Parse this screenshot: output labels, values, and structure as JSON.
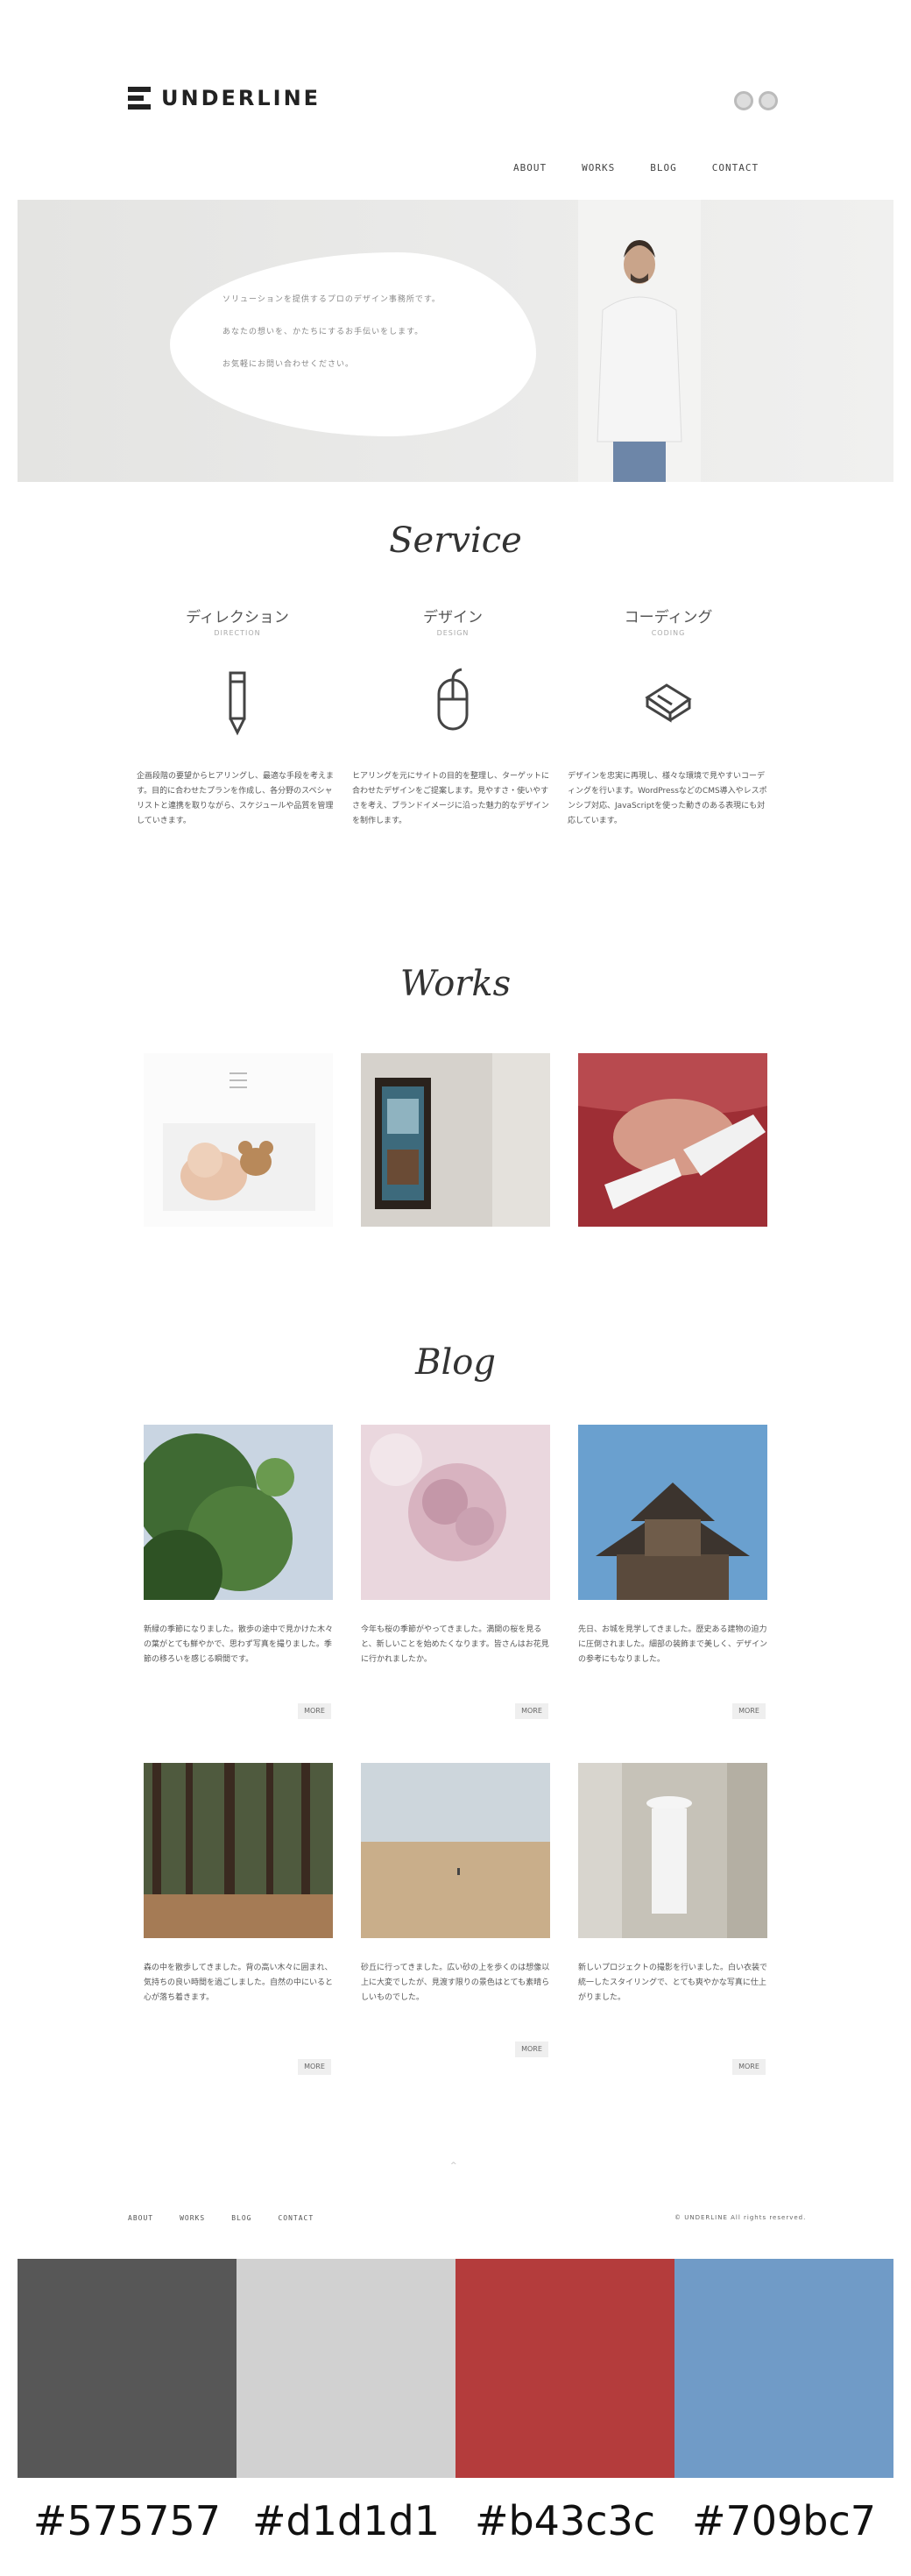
{
  "brand": {
    "name": "UNDERLINE"
  },
  "nav": [
    "ABOUT",
    "WORKS",
    "BLOG",
    "CONTACT"
  ],
  "hero": {
    "lines": [
      "ソリューションを提供するプロのデザイン事務所です。",
      "あなたの想いを、かたちにするお手伝いをします。",
      "お気軽にお問い合わせください。"
    ]
  },
  "sections": {
    "service": "Service",
    "works": "Works",
    "blog": "Blog"
  },
  "services": [
    {
      "title": "ディレクション",
      "sub": "DIRECTION",
      "icon": "pencil-icon",
      "text": "企画段階の要望からヒアリングし、最適な手段を考えます。目的に合わせたプランを作成し、各分野のスペシャリストと連携を取りながら、スケジュールや品質を管理していきます。"
    },
    {
      "title": "デザイン",
      "sub": "DESIGN",
      "icon": "mouse-icon",
      "text": "ヒアリングを元にサイトの目的を整理し、ターゲットに合わせたデザインをご提案します。見やすさ・使いやすさを考え、ブランドイメージに沿った魅力的なデザインを制作します。"
    },
    {
      "title": "コーディング",
      "sub": "CODING",
      "icon": "eraser-icon",
      "text": "デザインを忠実に再現し、様々な環境で見やすいコーディングを行います。WordPressなどのCMS導入やレスポンシブ対応、JavaScriptを使った動きのある表現にも対応しています。"
    }
  ],
  "blog": [
    {
      "text": "新緑の季節になりました。散歩の途中で見かけた木々の葉がとても鮮やかで、思わず写真を撮りました。季節の移ろいを感じる瞬間です。"
    },
    {
      "text": "今年も桜の季節がやってきました。満開の桜を見ると、新しいことを始めたくなります。皆さんはお花見に行かれましたか。"
    },
    {
      "text": "先日、お城を見学してきました。歴史ある建物の迫力に圧倒されました。細部の装飾まで美しく、デザインの参考にもなりました。"
    },
    {
      "text": "森の中を散歩してきました。背の高い木々に囲まれ、気持ちの良い時間を過ごしました。自然の中にいると心が落ち着きます。"
    },
    {
      "text": "砂丘に行ってきました。広い砂の上を歩くのは想像以上に大変でしたが、見渡す限りの景色はとても素晴らしいものでした。"
    },
    {
      "text": "新しいプロジェクトの撮影を行いました。白い衣装で統一したスタイリングで、とても爽やかな写真に仕上がりました。"
    }
  ],
  "more_label": "MORE",
  "footer": {
    "nav": [
      "ABOUT",
      "WORKS",
      "BLOG",
      "CONTACT"
    ],
    "copyright": "© UNDERLINE All rights reserved."
  },
  "palette": [
    {
      "hex": "#575757"
    },
    {
      "hex": "#d1d1d1"
    },
    {
      "hex": "#b43c3c"
    },
    {
      "hex": "#709bc7"
    }
  ]
}
